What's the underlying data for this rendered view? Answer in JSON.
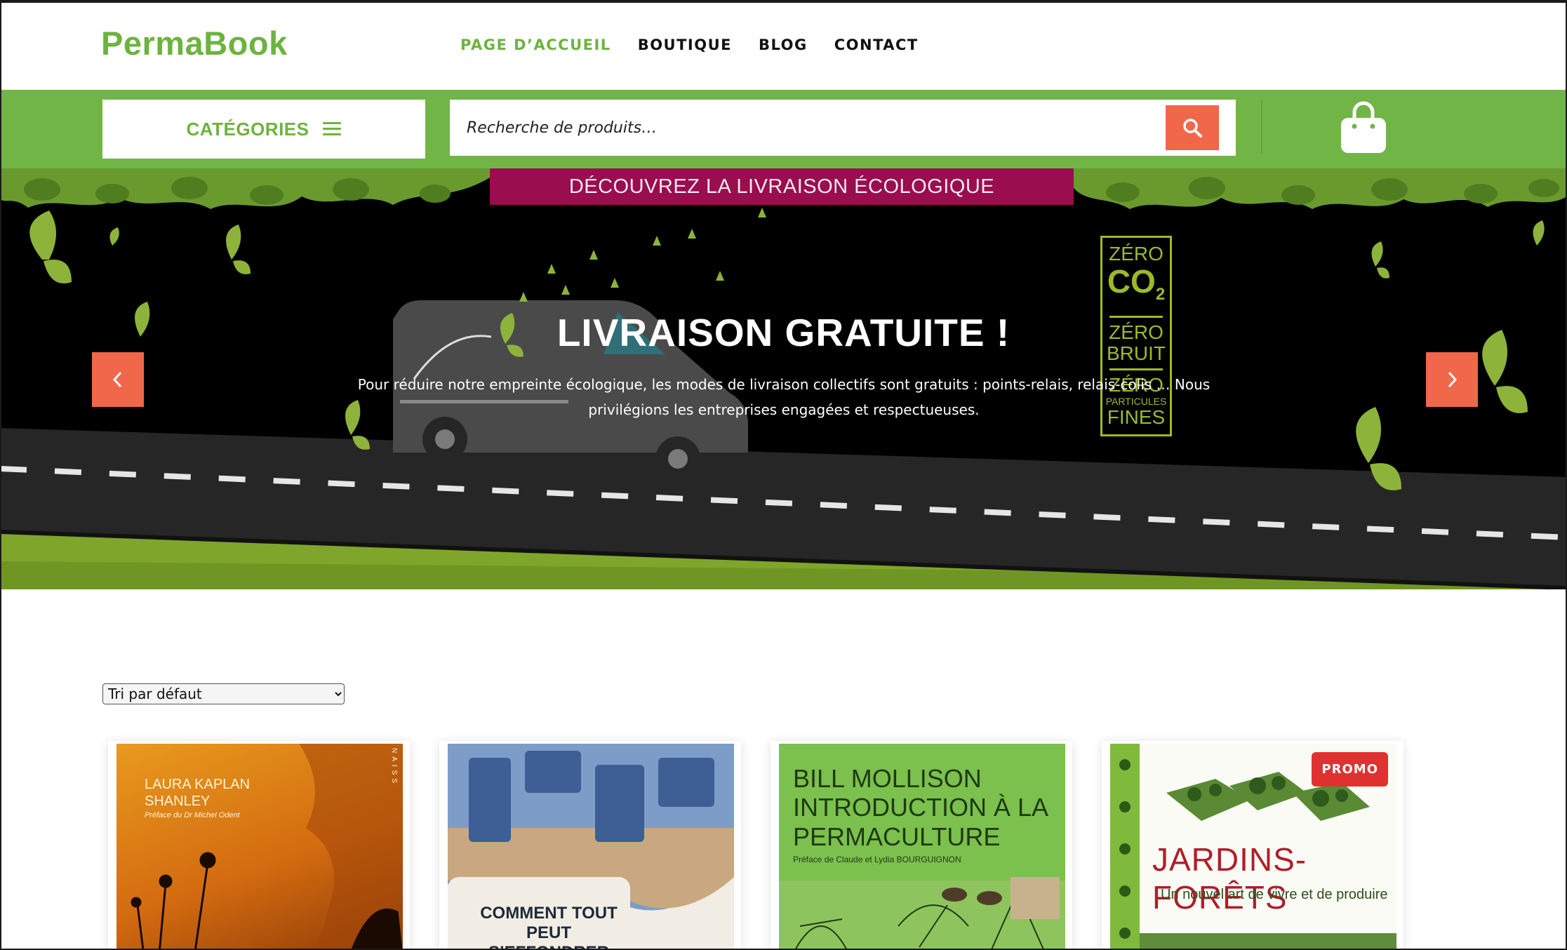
{
  "header": {
    "logo": "PermaBook",
    "nav": [
      {
        "label": "PAGE D’ACCUEIL",
        "active": true
      },
      {
        "label": "BOUTIQUE",
        "active": false
      },
      {
        "label": "BLOG",
        "active": false
      },
      {
        "label": "CONTACT",
        "active": false
      }
    ]
  },
  "toolbar": {
    "categories_label": "CATÉGORIES",
    "search_placeholder": "Recherche de produits…"
  },
  "hero": {
    "banner": "DÉCOUVREZ LA LIVRAISON ÉCOLOGIQUE",
    "title": "LIVRAISON GRATUITE !",
    "text": "Pour réduire notre empreinte écologique, les modes de livraison collectifs sont gratuits : points-relais, relais-colis … Nous privilégions les entreprises engagées et respectueuses.",
    "badge": {
      "line1": "ZÉRO",
      "line2": "CO",
      "line2_sub": "2",
      "line3": "ZÉRO",
      "line4": "BRUIT",
      "line5": "ZÉRO",
      "line6": "PARTICULES",
      "line7": "FINES"
    }
  },
  "shop": {
    "sort_selected": "Tri par défaut",
    "products": [
      {
        "cover_author": "LAURA KAPLAN SHANLEY",
        "cover_preface": "Préface du Dr Michel Odent",
        "cover_side": "NAISS"
      },
      {
        "cover_title": "COMMENT TOUT PEUT S’EFFONDRER"
      },
      {
        "cover_author": "BILL MOLLISON",
        "cover_title": "INTRODUCTION À LA PERMACULTURE",
        "cover_preface": "Préface de Claude et Lydia BOURGUIGNON"
      },
      {
        "badge": "PROMO",
        "cover_title": "JARDINS-FORÊTS",
        "cover_subtitle": "Un nouvel art de vivre et de produire"
      }
    ]
  },
  "colors": {
    "brand_green": "#72b547",
    "accent_orange": "#f0674a",
    "banner_magenta": "#9a0d4e",
    "promo_red": "#e03131"
  }
}
